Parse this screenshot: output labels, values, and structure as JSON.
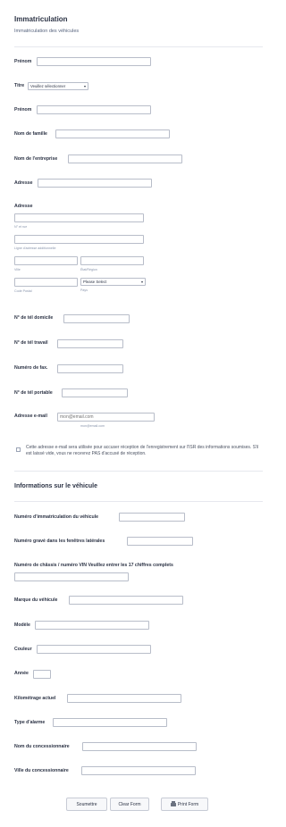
{
  "header": {
    "title": "Immatriculation",
    "subtitle": "Immatriculation des véhicules"
  },
  "fields": {
    "prenom1": {
      "label": "Prénom",
      "value": ""
    },
    "titre": {
      "label": "Titre",
      "value": "Veuillez sélectionner"
    },
    "prenom2": {
      "label": "Prénom",
      "value": ""
    },
    "nom_famille": {
      "label": "Nom de famille",
      "value": ""
    },
    "nom_entreprise": {
      "label": "Nom de l'entreprise",
      "value": ""
    },
    "adresse_simple": {
      "label": "Adresse",
      "value": ""
    },
    "adresse": {
      "label": "Adresse",
      "street_sub": "N° et rue",
      "line2_sub": "Ligne d'adresse additionnelle",
      "city_sub": "Ville",
      "state_sub": "État/Région",
      "postal_sub": "Code Postal",
      "country_sub": "Pays",
      "country_value": "Please Select"
    },
    "tel_domicile": {
      "label": "N° de tél domicile",
      "value": ""
    },
    "tel_travail": {
      "label": "N° de tél travail",
      "value": ""
    },
    "fax": {
      "label": "Numéro de fax.",
      "value": ""
    },
    "tel_portable": {
      "label": "N° de tél portable",
      "value": ""
    },
    "email": {
      "label": "Adresse e-mail",
      "placeholder": "mon@email.com",
      "sub": "mon@email.com"
    }
  },
  "consent": {
    "text": "Cette adresse e-mail sera utilisée pour accuser réception de l'enregistrement sur l'ISR des informations soumises. S'il est laissé vide, vous ne recevrez PAS d'accusé de réception."
  },
  "vehicle": {
    "heading": "Informations sur le véhicule",
    "immat": {
      "label": "Numéro d'immatriculation du véhicule",
      "value": ""
    },
    "grave": {
      "label": "Numéro gravé dans les fenêtres latérales",
      "value": ""
    },
    "vin": {
      "label": "Numéro de châssis / numéro VIN Veuillez entrer les 17 chiffres complets",
      "value": ""
    },
    "marque": {
      "label": "Marque du véhicule",
      "value": ""
    },
    "modele": {
      "label": "Modèle",
      "value": ""
    },
    "couleur": {
      "label": "Couleur",
      "value": ""
    },
    "annee": {
      "label": "Année",
      "value": ""
    },
    "kilometrage": {
      "label": "Kilométrage actuel",
      "value": ""
    },
    "alarme": {
      "label": "Type d'alarme",
      "value": ""
    },
    "concessionnaire": {
      "label": "Nom du concessionnaire",
      "value": ""
    },
    "ville_concessionnaire": {
      "label": "Ville du concessionnaire",
      "value": ""
    }
  },
  "buttons": {
    "submit": "Soumettre",
    "clear": "Clear Form",
    "print": "Print Form"
  },
  "icons": {
    "select_caret": "chevron-down-icon",
    "print": "printer-icon"
  },
  "colors": {
    "text": "#2c3345",
    "border": "#b8bdc9",
    "divider": "#e6e8ee",
    "button_bg": "#f7f8fa"
  }
}
